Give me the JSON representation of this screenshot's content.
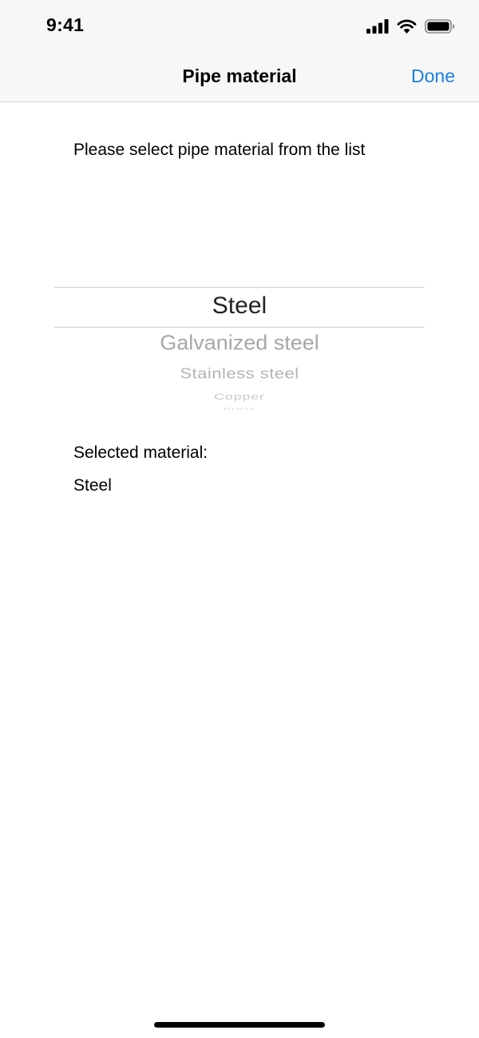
{
  "status_bar": {
    "time": "9:41",
    "icons": [
      "cellular-signal-icon",
      "wifi-icon",
      "battery-icon"
    ]
  },
  "nav": {
    "title": "Pipe material",
    "done_label": "Done"
  },
  "content": {
    "instruction": "Please select pipe material from the list",
    "picker": {
      "selected": "Steel",
      "options_below": [
        "Galvanized steel",
        "Stainless steel",
        "Copper",
        "Brass"
      ]
    },
    "selected_label": "Selected material:",
    "selected_value": "Steel"
  },
  "colors": {
    "accent": "#1b7ee3",
    "bar_background": "#f7f7f7",
    "separator": "#d8d8d8"
  }
}
